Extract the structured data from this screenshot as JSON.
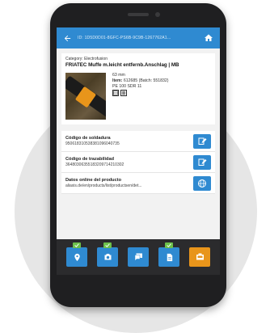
{
  "header": {
    "title": "ID: 1D5D0D01-8GFC-PS6B-9C9B-1267762A1...",
    "back_icon": "arrow-left-icon",
    "home_icon": "home-icon",
    "color": "#2f8ad1"
  },
  "product": {
    "category": "Category: Electrofusion",
    "title": "FRIATEC Muffe m.leicht entfernb.Anschlag | MB",
    "size": "63 mm",
    "item_label": "Item:",
    "item_value": " 612685 (Batch: 551832)",
    "material": "PE 100 SDR 11"
  },
  "info_rows": [
    {
      "label": "Código de soldadura",
      "value": "95061831053838109604073​5",
      "icon": "edit-icon"
    },
    {
      "label": "Código de trazabilidad",
      "value": "36480306355183209714210302",
      "icon": "edit-icon"
    },
    {
      "label": "Datos online del producto",
      "value": "aliaxis.de/en/products/list/productsen/det...",
      "icon": "globe-icon"
    }
  ],
  "bottom_nav": [
    {
      "name": "location",
      "icon": "map-pin-icon",
      "badge": true
    },
    {
      "name": "camera",
      "icon": "camera-icon",
      "badge": true
    },
    {
      "name": "comments",
      "icon": "chat-icon",
      "badge": false
    },
    {
      "name": "documents",
      "icon": "document-icon",
      "badge": true
    },
    {
      "name": "machine",
      "icon": "welding-machine-icon",
      "badge": false
    }
  ],
  "colors": {
    "accent": "#2f8ad1",
    "badge": "#6cc04a",
    "highlight": "#e8951b"
  }
}
